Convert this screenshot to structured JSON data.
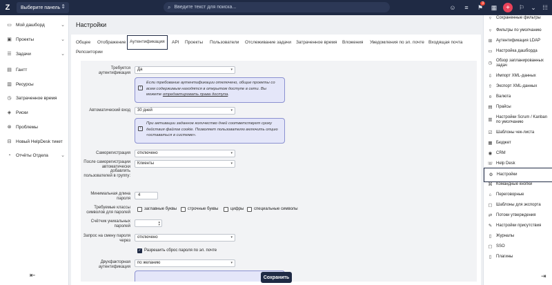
{
  "topbar": {
    "logo": "Z",
    "panel_select": "Выберите панель",
    "search_placeholder": "Введите текст для поиска...",
    "notification_count": "3"
  },
  "sidebar": {
    "items": [
      {
        "label": "Мой дашборд",
        "icon": "monitor-icon",
        "expand": true
      },
      {
        "label": "Проекты",
        "icon": "briefcase-icon",
        "expand": true
      },
      {
        "label": "Задачи",
        "icon": "tasks-icon",
        "expand": true
      },
      {
        "label": "Гантт",
        "icon": "gantt-icon",
        "expand": false
      },
      {
        "label": "Ресурсы",
        "icon": "resources-icon",
        "expand": false
      },
      {
        "label": "Затраченное время",
        "icon": "clock-icon",
        "expand": false
      },
      {
        "label": "Риски",
        "icon": "risk-icon",
        "expand": false
      },
      {
        "label": "Проблемы",
        "icon": "problem-icon",
        "expand": false
      },
      {
        "label": "Новый HelpDesk тикет",
        "icon": "ticket-icon",
        "expand": false
      },
      {
        "label": "Отчёты Отдела",
        "icon": "reports-icon",
        "expand": true
      }
    ]
  },
  "page": {
    "title": "Настройки",
    "tabs": [
      "Общее",
      "Отображение",
      "Аутентификация",
      "API",
      "Проекты",
      "Пользователи",
      "Отслеживание задачи",
      "Затраченное время",
      "Вложения",
      "Уведомления по эл. почте",
      "Входящая почта",
      "Репозитории"
    ],
    "active_tab": "Аутентификация"
  },
  "form": {
    "auth_required_label": "Требуется аутентификация",
    "auth_required_value": "Да",
    "auth_info_1": "Если требование аутентификации отключено, общие проекты со всем содержимым находятся в открытом доступе в сети. Вы можете ",
    "auth_info_link": "отредактировать права доступа",
    "auth_info_end": ".",
    "autologin_label": "Автоматический вход",
    "autologin_value": "30 дней",
    "autologin_info": "При активации заданное количество дней соответствует сроку действия файлов cookie. Позволяет пользователю включить опцию «оставаться в системе».",
    "selfreg_label": "Саморегистрация",
    "selfreg_value": "отключено",
    "after_selfreg_label": "После саморегистрации автоматически добавлять пользователей в группу:",
    "after_selfreg_value": "Клиенты",
    "min_pw_label": "Минимальная длина пароля",
    "min_pw_value": "4",
    "char_classes_label": "Требуемые классы символов для паролей",
    "char_classes": [
      "заглавные буквы",
      "строчные буквы",
      "цифры",
      "специальные символы"
    ],
    "unique_pw_label": "Счётчик уникальных паролей",
    "pw_change_label": "Запрос на смену пароля через",
    "pw_change_value": "отключено",
    "pw_reset_label": "Разрешить сброс пароля по эл. почте",
    "twofa_label": "Двухфакторная аутентификация",
    "twofa_value": "по желанию",
    "save_label": "Сохранить"
  },
  "right_panel": {
    "items": [
      {
        "label": "Сохраненные фильтры",
        "icon": "filter-icon"
      },
      {
        "label": "Фильтры по умолчанию",
        "icon": "filter-icon"
      },
      {
        "label": "Аутентификация LDAP",
        "icon": "ldap-icon"
      },
      {
        "label": "Настройка дашборда",
        "icon": "dashboard-icon"
      },
      {
        "label": "Обзор запланированных задач",
        "icon": "schedule-icon"
      },
      {
        "label": "Импорт XML-данных",
        "icon": "import-icon"
      },
      {
        "label": "Экспорт XML-данных",
        "icon": "export-icon"
      },
      {
        "label": "Валюта",
        "icon": "currency-icon"
      },
      {
        "label": "Прайсы",
        "icon": "price-icon"
      },
      {
        "label": "Настройки Scrum / Kanban по умолчанию",
        "icon": "kanban-icon"
      },
      {
        "label": "Шаблоны чек-листа",
        "icon": "checklist-icon"
      },
      {
        "label": "Бюджет",
        "icon": "budget-icon"
      },
      {
        "label": "CRM",
        "icon": "crm-icon"
      },
      {
        "label": "Help Desk",
        "icon": "helpdesk-icon"
      },
      {
        "label": "Настройки",
        "icon": "settings-icon"
      },
      {
        "label": "Командные кнопки",
        "icon": "command-icon"
      },
      {
        "label": "Переговорные",
        "icon": "meeting-icon"
      },
      {
        "label": "Шаблоны для экспорта",
        "icon": "template-icon"
      },
      {
        "label": "Потоки утверждения",
        "icon": "approval-icon"
      },
      {
        "label": "Настройки присутствия",
        "icon": "presence-icon"
      },
      {
        "label": "Журналы",
        "icon": "journal-icon"
      },
      {
        "label": "SSO",
        "icon": "sso-icon"
      },
      {
        "label": "Плагины",
        "icon": "plugin-icon"
      }
    ],
    "active": "Настройки"
  }
}
